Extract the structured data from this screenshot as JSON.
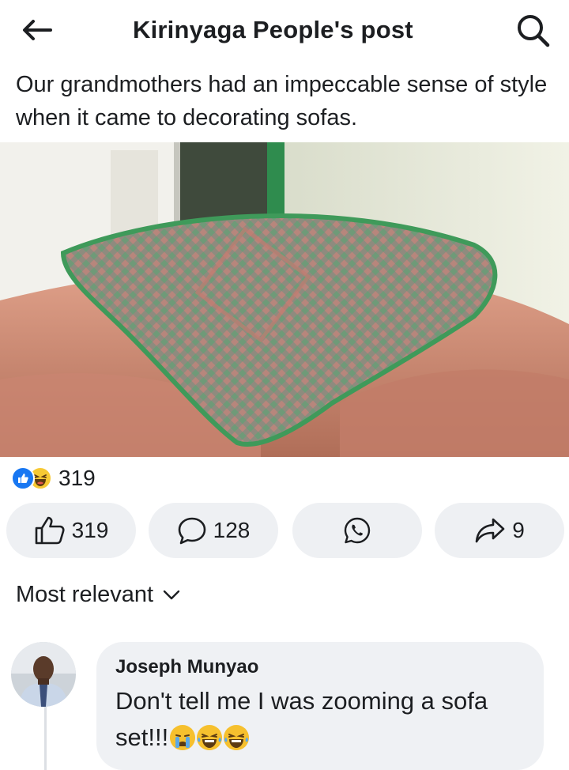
{
  "header": {
    "title": "Kirinyaga People's post",
    "back_icon": "arrow-left-icon",
    "search_icon": "search-icon"
  },
  "post": {
    "text": "Our grandmothers had an impeccable sense of style when it came to decorating sofas.",
    "reactions": {
      "icons": [
        "like-reaction-icon",
        "haha-reaction-icon"
      ],
      "count": "319"
    },
    "actions": {
      "like_count": "319",
      "comment_count": "128",
      "share_count": "9"
    }
  },
  "comments": {
    "sort_label": "Most relevant",
    "items": [
      {
        "author": "Joseph Munyao",
        "text": "Don't tell me I was zooming a sofa set!!!",
        "emojis": [
          "crying-face-emoji",
          "laughing-tears-emoji",
          "laughing-tears-emoji"
        ]
      }
    ]
  },
  "colors": {
    "accent": "#1877f2",
    "button_bg": "#eef0f3",
    "bubble_bg": "#eff1f4",
    "text": "#1c1e21"
  }
}
